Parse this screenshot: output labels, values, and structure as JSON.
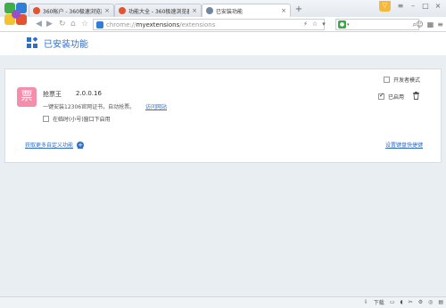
{
  "browser": {
    "tabs": [
      {
        "label": "360帐户 - 360极速浏览器",
        "active": false,
        "fav_color": "#e4532e"
      },
      {
        "label": "功能大全 - 360极速浏览器",
        "active": false,
        "fav_color": "#e4532e"
      },
      {
        "label": "已安装功能",
        "active": true,
        "fav_color": "#6f86a3"
      }
    ],
    "badge": "▽",
    "address": {
      "prefix": "chrome://",
      "main": "myextensions",
      "suffix": "/extensions"
    }
  },
  "page": {
    "title": "已安装功能",
    "developer_mode_label": "开发者模式",
    "extension": {
      "icon_char": "票",
      "name": "抢票王",
      "version": "2.0.0.16",
      "description": "一键安装12306官网证书，自动抢票。",
      "site_link": "访问网站",
      "incognito_label": "在临时(小号)窗口下启用",
      "enabled_label": "已启用"
    },
    "get_more": "获取更多自定义功能",
    "shortcuts": "设置键盘快捷键"
  },
  "statusbar": {
    "download": "下载"
  },
  "colors": {
    "accent": "#2f6fc5",
    "ext_icon": "#f58eab",
    "badge": "#f6b73c"
  }
}
